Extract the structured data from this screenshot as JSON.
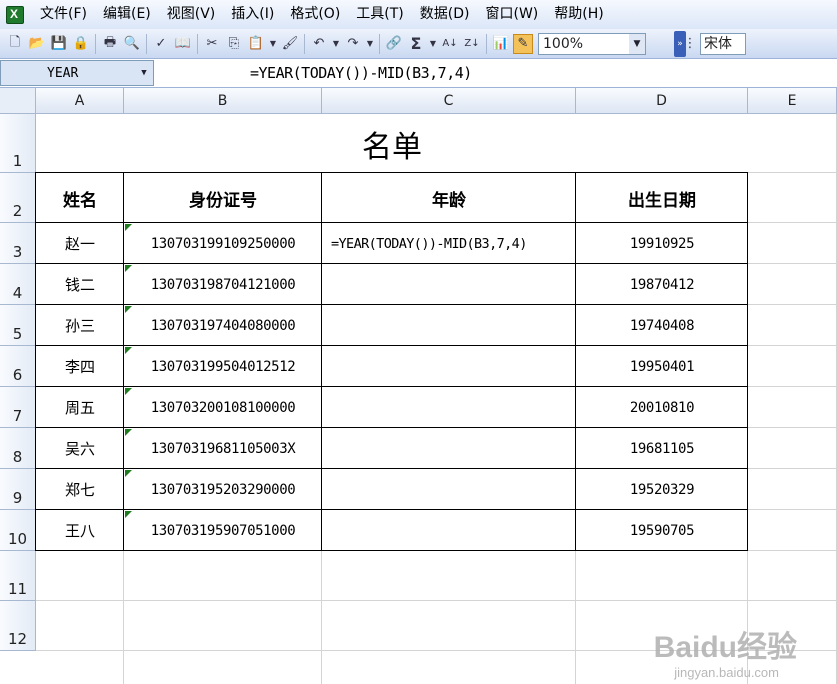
{
  "menu": [
    "文件(F)",
    "编辑(E)",
    "视图(V)",
    "插入(I)",
    "格式(O)",
    "工具(T)",
    "数据(D)",
    "窗口(W)",
    "帮助(H)"
  ],
  "toolbar": {
    "zoom": "100%",
    "font": "宋体",
    "icons": [
      "new-icon",
      "open-icon",
      "save-icon",
      "permission-icon",
      "print-icon",
      "print-preview-icon",
      "spelling-icon",
      "research-icon",
      "cut-icon",
      "copy-icon",
      "paste-icon",
      "format-painter-icon",
      "undo-icon",
      "redo-icon",
      "hyperlink-icon",
      "autosum-icon",
      "sort-ascending-icon",
      "sort-descending-icon",
      "chart-wizard-icon",
      "drawing-icon"
    ]
  },
  "formula_bar": {
    "name_box": "YEAR",
    "formula": "=YEAR(TODAY())-MID(B3,7,4)"
  },
  "columns": [
    "A",
    "B",
    "C",
    "D",
    "E"
  ],
  "rows": [
    "1",
    "2",
    "3",
    "4",
    "5",
    "6",
    "7",
    "8",
    "9",
    "10",
    "11",
    "12"
  ],
  "sheet": {
    "title": "名单",
    "headers": [
      "姓名",
      "身份证号",
      "年龄",
      "出生日期"
    ],
    "records": [
      {
        "name": "赵一",
        "id": "130703199109250000",
        "age": "=YEAR(TODAY())-MID(B3,7,4)",
        "birth": "19910925"
      },
      {
        "name": "钱二",
        "id": "130703198704121000",
        "age": "",
        "birth": "19870412"
      },
      {
        "name": "孙三",
        "id": "130703197404080000",
        "age": "",
        "birth": "19740408"
      },
      {
        "name": "李四",
        "id": "130703199504012512",
        "age": "",
        "birth": "19950401"
      },
      {
        "name": "周五",
        "id": "130703200108100000",
        "age": "",
        "birth": "20010810"
      },
      {
        "name": "吴六",
        "id": "13070319681105003X",
        "age": "",
        "birth": "19681105"
      },
      {
        "name": "郑七",
        "id": "130703195203290000",
        "age": "",
        "birth": "19520329"
      },
      {
        "name": "王八",
        "id": "130703195907051000",
        "age": "",
        "birth": "19590705"
      }
    ]
  },
  "watermark": {
    "brand": "Baidu经验",
    "url": "jingyan.baidu.com"
  }
}
